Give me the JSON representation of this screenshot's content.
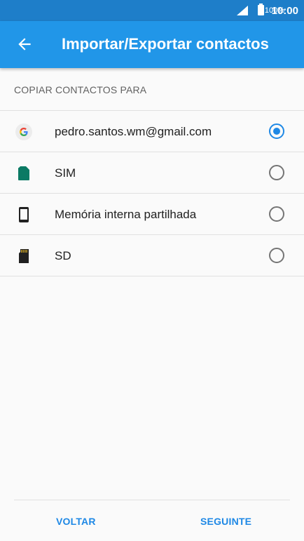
{
  "status_bar": {
    "battery": "100%",
    "time": "10:00"
  },
  "app_bar": {
    "title": "Importar/Exportar contactos",
    "back_icon": "arrow-left-icon"
  },
  "section": {
    "header": "COPIAR CONTACTOS PARA"
  },
  "options": [
    {
      "label": "pedro.santos.wm@gmail.com",
      "icon": "google-icon",
      "selected": true
    },
    {
      "label": "SIM",
      "icon": "sim-card-icon",
      "selected": false
    },
    {
      "label": "Memória interna partilhada",
      "icon": "phone-icon",
      "selected": false
    },
    {
      "label": "SD",
      "icon": "sd-card-icon",
      "selected": false
    }
  ],
  "footer": {
    "back_label": "VOLTAR",
    "next_label": "SEGUINTE"
  },
  "colors": {
    "status_bar": "#1e7ec9",
    "app_bar": "#2196e8",
    "accent": "#1e88e5",
    "sim": "#0b7a64"
  }
}
